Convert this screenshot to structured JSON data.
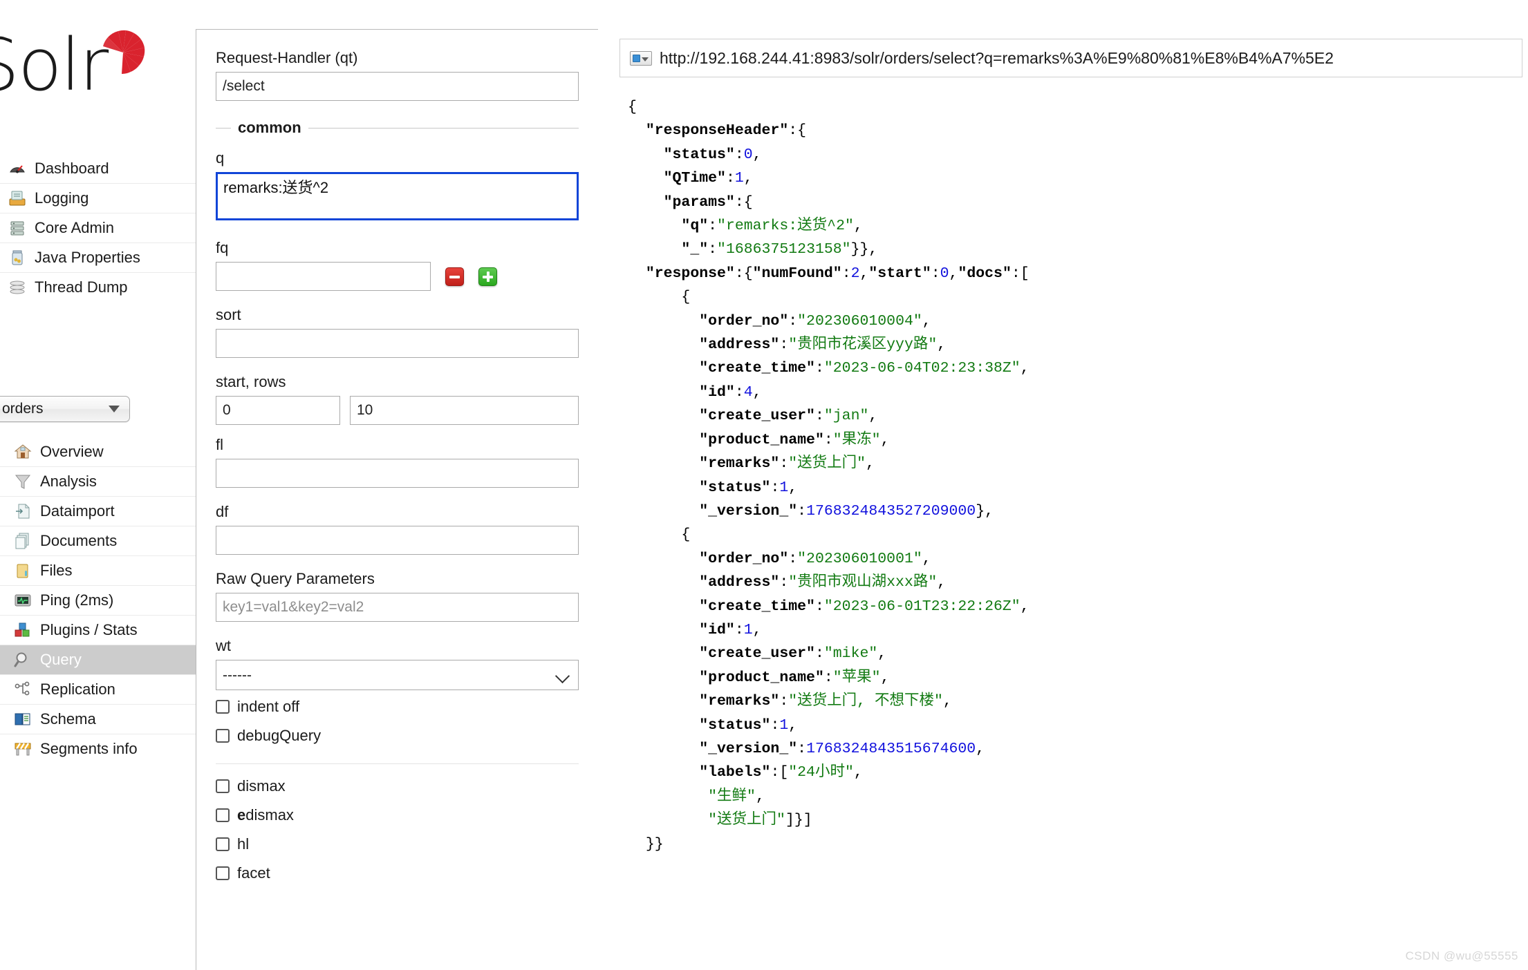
{
  "brand": {
    "name": "Solr",
    "logo_icon": "solr-sunburst-logo"
  },
  "sidebar": {
    "top_items": [
      {
        "label": "Dashboard",
        "icon": "dashboard-gauge-icon"
      },
      {
        "label": "Logging",
        "icon": "logging-tray-icon"
      },
      {
        "label": "Core Admin",
        "icon": "core-admin-servers-icon"
      },
      {
        "label": "Java Properties",
        "icon": "java-properties-jar-icon"
      },
      {
        "label": "Thread Dump",
        "icon": "thread-dump-stack-icon"
      }
    ],
    "core_selector": {
      "value": "orders",
      "caret_icon": "chevron-down-icon"
    },
    "core_items": [
      {
        "label": "Overview",
        "icon": "home-icon",
        "active": false
      },
      {
        "label": "Analysis",
        "icon": "funnel-icon",
        "active": false
      },
      {
        "label": "Dataimport",
        "icon": "dataimport-page-icon",
        "active": false
      },
      {
        "label": "Documents",
        "icon": "documents-stack-icon",
        "active": false
      },
      {
        "label": "Files",
        "icon": "folder-icon",
        "active": false
      },
      {
        "label": "Ping (2ms)",
        "icon": "ping-monitor-icon",
        "active": false
      },
      {
        "label": "Plugins / Stats",
        "icon": "plugins-blocks-icon",
        "active": false
      },
      {
        "label": "Query",
        "icon": "magnifier-icon",
        "active": true
      },
      {
        "label": "Replication",
        "icon": "replication-nodes-icon",
        "active": false
      },
      {
        "label": "Schema",
        "icon": "schema-book-icon",
        "active": false
      },
      {
        "label": "Segments info",
        "icon": "segments-barrier-icon",
        "active": false
      }
    ]
  },
  "query_form": {
    "request_handler_label": "Request-Handler (qt)",
    "request_handler_value": "/select",
    "common_legend": "common",
    "q_label": "q",
    "q_value": "remarks:送货^2",
    "fq_label": "fq",
    "fq_value": "",
    "fq_remove_icon": "minus-button-icon",
    "fq_add_icon": "plus-button-icon",
    "sort_label": "sort",
    "sort_value": "",
    "start_rows_label": "start, rows",
    "start_value": "0",
    "rows_value": "10",
    "fl_label": "fl",
    "fl_value": "",
    "df_label": "df",
    "df_value": "",
    "raw_query_label": "Raw Query Parameters",
    "raw_query_placeholder": "key1=val1&key2=val2",
    "raw_query_value": "",
    "wt_label": "wt",
    "wt_value": "------",
    "wt_options": [
      "------"
    ],
    "checkboxes_group1": [
      {
        "label": "indent off",
        "checked": false,
        "bold_prefix": ""
      },
      {
        "label": "debugQuery",
        "checked": false,
        "bold_prefix": ""
      }
    ],
    "checkboxes_group2": [
      {
        "label": "dismax",
        "checked": false,
        "bold_prefix": ""
      },
      {
        "label": "dismax",
        "checked": false,
        "bold_prefix": "e"
      },
      {
        "label": "hl",
        "checked": false,
        "bold_prefix": ""
      },
      {
        "label": "facet",
        "checked": false,
        "bold_prefix": ""
      }
    ]
  },
  "result": {
    "url_icon": "new-window-dropdown-icon",
    "url": "http://192.168.244.41:8983/solr/orders/select?q=remarks%3A%E9%80%81%E8%B4%A7%5E2",
    "response": {
      "responseHeader": {
        "status": 0,
        "QTime": 1,
        "params": {
          "q": "remarks:送货^2",
          "_": "1686375123158"
        }
      },
      "response": {
        "numFound": 2,
        "start": 0,
        "docs": [
          {
            "order_no": "202306010004",
            "address": "贵阳市花溪区yyy路",
            "create_time": "2023-06-04T02:23:38Z",
            "id": 4,
            "create_user": "jan",
            "product_name": "果冻",
            "remarks": "送货上门",
            "status": 1,
            "_version_": 1768324843527208960
          },
          {
            "order_no": "202306010001",
            "address": "贵阳市观山湖xxx路",
            "create_time": "2023-06-01T23:22:26Z",
            "id": 1,
            "create_user": "mike",
            "product_name": "苹果",
            "remarks": "送货上门, 不想下楼",
            "status": 1,
            "_version_": 1768324843515674624,
            "labels": [
              "24小时",
              "生鲜",
              "送货上门"
            ]
          }
        ]
      }
    }
  },
  "watermark": "CSDN @wu@55555",
  "colors": {
    "solr_red": "#d9232e",
    "focus_blue": "#1145d8",
    "json_string_green": "#127a12",
    "json_number_blue": "#1111dd",
    "active_nav_bg": "#cccccc"
  }
}
